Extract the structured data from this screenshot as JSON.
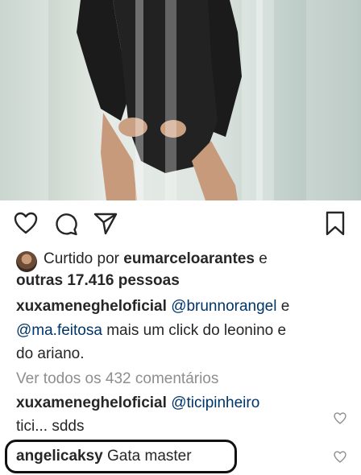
{
  "post": {
    "liked_by_prefix": "Curtido por ",
    "liked_by_user": "eumarceloarantes",
    "liked_by_suffix": " e",
    "liked_others": "outras 17.416 pessoas",
    "caption": {
      "author": "xuxamenegheloficial",
      "mention1": "@brunnorangel",
      "joiner": " e",
      "mention2": "@ma.feitosa",
      "text_line2_rest": " mais um click do leonino e",
      "text_line3": "do ariano."
    },
    "view_all_comments": "Ver todos os 432 comentários"
  },
  "comments": [
    {
      "author": "xuxamenegheloficial",
      "mention": "@ticipinheiro",
      "text_line2": "tici... sdds"
    },
    {
      "author": "angelicaksy",
      "text": "Gata master"
    }
  ],
  "icons": {
    "like": "heart-icon",
    "comment": "comment-icon",
    "share": "send-icon",
    "save": "bookmark-icon",
    "comment_like": "heart-icon"
  },
  "colors": {
    "text": "#262626",
    "muted": "#8e8e8e",
    "mention": "#003569"
  }
}
